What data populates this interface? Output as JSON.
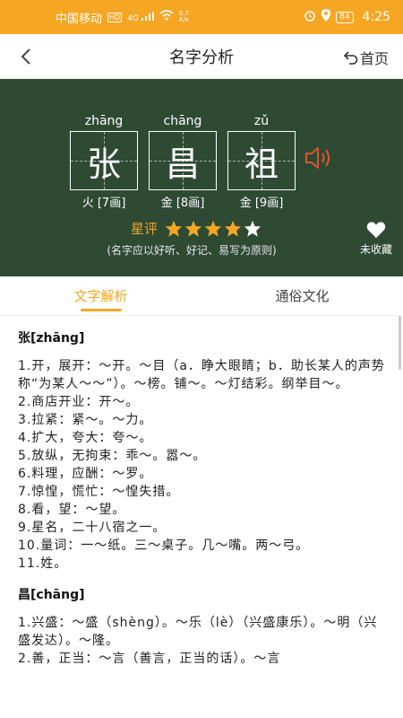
{
  "status": {
    "carrier": "中国移动",
    "hd": "HD",
    "signal": "4G",
    "speed_top": "6.7",
    "speed_bottom": "K/s",
    "battery": "84",
    "time": "4:25"
  },
  "nav": {
    "title": "名字分析",
    "home_label": "首页"
  },
  "name_chars": [
    {
      "pinyin": "zhāng",
      "char": "张",
      "element": "火 [7画]"
    },
    {
      "pinyin": "chāng",
      "char": "昌",
      "element": "金 [8画]"
    },
    {
      "pinyin": "zǔ",
      "char": "祖",
      "element": "金 [9画]"
    }
  ],
  "rating": {
    "label": "星评",
    "stars": 5,
    "note": "(名字应以好听、好记、易写为原则)"
  },
  "favorite_label": "未收藏",
  "tabs": [
    {
      "label": "文字解析",
      "active": true
    },
    {
      "label": "通俗文化",
      "active": false
    }
  ],
  "sections": [
    {
      "head": "张[zhāng]",
      "lines": [
        "1.开，展开：～开。～目（a．睁大眼睛；b．助长某人的声势称“为某人～～”）。～榜。铺～。～灯结彩。纲举目～。",
        "2.商店开业：开～。",
        "3.拉紧：紧～。～力。",
        "4.扩大，夸大：夸～。",
        "5.放纵，无拘束：乖～。嚣～。",
        "6.料理，应酬：～罗。",
        "7.惊惶，慌忙：～惶失措。",
        "8.看，望：～望。",
        "9.星名，二十八宿之一。",
        "10.量词：一～纸。三～桌子。几～嘴。两～弓。",
        "11.姓。"
      ]
    },
    {
      "head": "昌[chāng]",
      "lines": [
        "1.兴盛：～盛（shèng）。～乐（lè）（兴盛康乐）。～明（兴盛发达）。～隆。",
        "2.善，正当：～言（善言，正当的话）。～言"
      ]
    }
  ],
  "colors": {
    "accent": "#f5a623",
    "hero_bg": "#2e4a33"
  }
}
